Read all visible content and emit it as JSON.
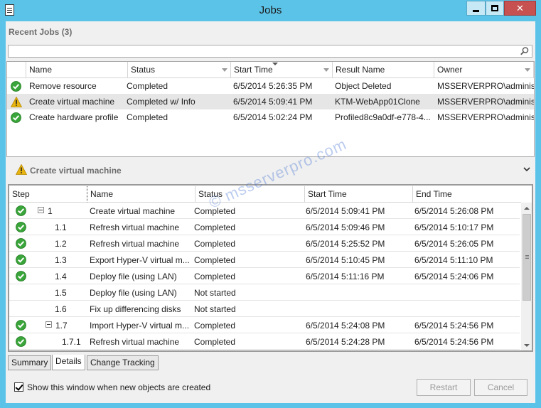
{
  "window": {
    "title": "Jobs",
    "controls": [
      "minimize",
      "maximize",
      "close"
    ]
  },
  "recent_jobs": {
    "heading": "Recent Jobs (3)",
    "search": {
      "value": "",
      "placeholder": ""
    },
    "columns": [
      "",
      "Name",
      "Status",
      "Start Time",
      "Result Name",
      "Owner"
    ],
    "rows": [
      {
        "icon": "success",
        "name": "Remove resource",
        "status": "Completed",
        "start": "6/5/2014 5:26:35 PM",
        "result": "Object Deleted",
        "owner": "MSSERVERPRO\\adminis..."
      },
      {
        "icon": "warning",
        "name": "Create virtual machine",
        "status": "Completed w/ Info",
        "start": "6/5/2014 5:09:41 PM",
        "result": "KTM-WebApp01Clone",
        "owner": "MSSERVERPRO\\adminis...",
        "selected": true
      },
      {
        "icon": "success",
        "name": "Create hardware profile",
        "status": "Completed",
        "start": "6/5/2014 5:02:24 PM",
        "result": "Profiled8c9a0df-e778-4...",
        "owner": "MSSERVERPRO\\adminis..."
      }
    ]
  },
  "detail": {
    "heading": "Create virtual machine",
    "columns": [
      "Step",
      "Name",
      "Status",
      "Start Time",
      "End Time"
    ],
    "steps": [
      {
        "icon": "success",
        "toggle": true,
        "step": "1",
        "name": "Create virtual machine",
        "status": "Completed",
        "start": "6/5/2014 5:09:41 PM",
        "end": "6/5/2014 5:26:08 PM"
      },
      {
        "icon": "success",
        "toggle": false,
        "step": "1.1",
        "name": "Refresh virtual machine",
        "status": "Completed",
        "start": "6/5/2014 5:09:46 PM",
        "end": "6/5/2014 5:10:17 PM"
      },
      {
        "icon": "success",
        "toggle": false,
        "step": "1.2",
        "name": "Refresh virtual machine",
        "status": "Completed",
        "start": "6/5/2014 5:25:52 PM",
        "end": "6/5/2014 5:26:05 PM"
      },
      {
        "icon": "success",
        "toggle": false,
        "step": "1.3",
        "name": "Export Hyper-V virtual m...",
        "status": "Completed",
        "start": "6/5/2014 5:10:45 PM",
        "end": "6/5/2014 5:11:10 PM"
      },
      {
        "icon": "success",
        "toggle": false,
        "step": "1.4",
        "name": "Deploy file (using LAN)",
        "status": "Completed",
        "start": "6/5/2014 5:11:16 PM",
        "end": "6/5/2014 5:24:06 PM"
      },
      {
        "icon": "none",
        "toggle": false,
        "step": "1.5",
        "name": "Deploy file (using LAN)",
        "status": "Not started",
        "start": "",
        "end": ""
      },
      {
        "icon": "none",
        "toggle": false,
        "step": "1.6",
        "name": "Fix up differencing disks",
        "status": "Not started",
        "start": "",
        "end": ""
      },
      {
        "icon": "success",
        "toggle": true,
        "step": "1.7",
        "name": "Import Hyper-V virtual m...",
        "status": "Completed",
        "start": "6/5/2014 5:24:08 PM",
        "end": "6/5/2014 5:24:56 PM"
      },
      {
        "icon": "success",
        "toggle": false,
        "step": "1.7.1",
        "name": "Refresh virtual machine",
        "status": "Completed",
        "start": "6/5/2014 5:24:28 PM",
        "end": "6/5/2014 5:24:56 PM"
      }
    ]
  },
  "tabs": [
    "Summary",
    "Details",
    "Change Tracking"
  ],
  "active_tab": "Details",
  "footer": {
    "checkbox_label": "Show this window when new objects are created",
    "checkbox_checked": true,
    "restart_label": "Restart",
    "cancel_label": "Cancel"
  },
  "watermark": "© msserverpro.com",
  "colors": {
    "frame": "#5cc3e8",
    "success": "#3aa53a",
    "warning": "#e8b40f",
    "close": "#c75050"
  }
}
